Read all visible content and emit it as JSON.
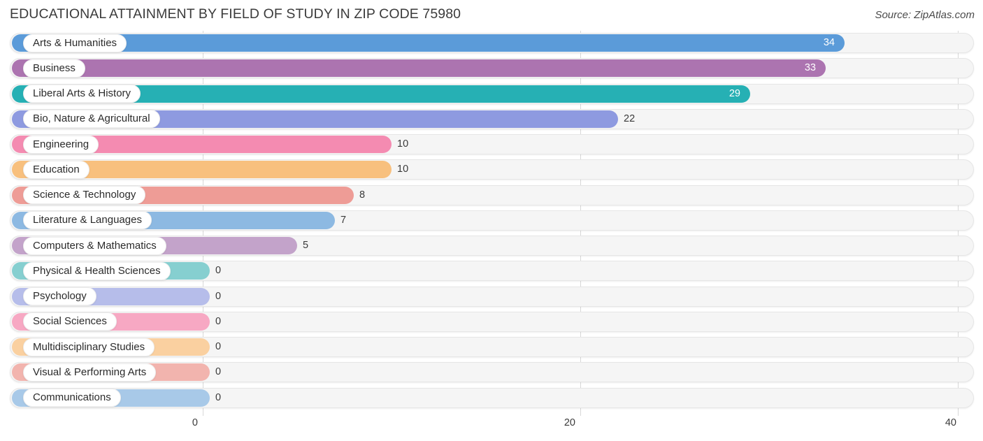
{
  "header": {
    "title": "EDUCATIONAL ATTAINMENT BY FIELD OF STUDY IN ZIP CODE 75980",
    "source": "Source: ZipAtlas.com"
  },
  "axis": {
    "ticks": [
      "0",
      "20",
      "40"
    ]
  },
  "chart_data": {
    "type": "bar",
    "orientation": "horizontal",
    "title": "EDUCATIONAL ATTAINMENT BY FIELD OF STUDY IN ZIP CODE 75980",
    "subtitle": "Source: ZipAtlas.com",
    "xlabel": "",
    "ylabel": "",
    "xlim": [
      0,
      40
    ],
    "xticks": [
      0,
      20,
      40
    ],
    "grid": true,
    "legend": false,
    "categories": [
      "Arts & Humanities",
      "Business",
      "Liberal Arts & History",
      "Bio, Nature & Agricultural",
      "Engineering",
      "Education",
      "Science & Technology",
      "Literature & Languages",
      "Computers & Mathematics",
      "Physical & Health Sciences",
      "Psychology",
      "Social Sciences",
      "Multidisciplinary Studies",
      "Visual & Performing Arts",
      "Communications"
    ],
    "values": [
      34,
      33,
      29,
      22,
      10,
      10,
      8,
      7,
      5,
      0,
      0,
      0,
      0,
      0,
      0
    ],
    "value_labels": [
      "34",
      "33",
      "29",
      "22",
      "10",
      "10",
      "8",
      "7",
      "5",
      "0",
      "0",
      "0",
      "0",
      "0",
      "0"
    ],
    "colors": [
      "#5b9bd9",
      "#ac74b0",
      "#26b0b4",
      "#8e9ae0",
      "#f48bb1",
      "#f8c07e",
      "#ee9c96",
      "#8db9e2",
      "#c3a3ca",
      "#86cfd0",
      "#b6bdea",
      "#f7a8c3",
      "#fad0a0",
      "#f2b4ae",
      "#a8c9e8"
    ]
  }
}
